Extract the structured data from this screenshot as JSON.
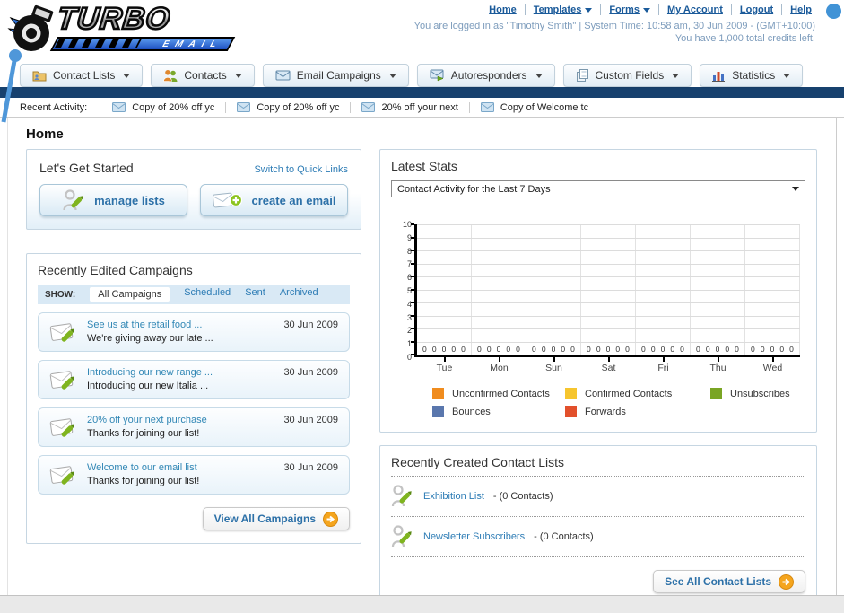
{
  "header": {
    "logo": {
      "line1": "TURBO",
      "line2": "EMAIL"
    },
    "nav": {
      "home": "Home",
      "templates": "Templates",
      "forms": "Forms",
      "my_account": "My Account",
      "logout": "Logout",
      "help": "Help"
    },
    "login_line1": "You are logged in as \"Timothy Smith\" | System Time: 10:58 am, 30 Jun 2009 - (GMT+10:00)",
    "login_line2": "You have 1,000 total credits left."
  },
  "tabs": [
    {
      "label": "Contact Lists",
      "icon": "contact-lists-icon"
    },
    {
      "label": "Contacts",
      "icon": "contacts-icon"
    },
    {
      "label": "Email Campaigns",
      "icon": "email-campaigns-icon"
    },
    {
      "label": "Autoresponders",
      "icon": "autoresponders-icon"
    },
    {
      "label": "Custom Fields",
      "icon": "custom-fields-icon"
    },
    {
      "label": "Statistics",
      "icon": "statistics-icon"
    }
  ],
  "recent_activity": {
    "label": "Recent Activity:",
    "items": [
      "Copy of 20% off yc",
      "Copy of 20% off yc",
      "20% off your next ",
      "Copy of Welcome tc"
    ]
  },
  "main": {
    "page_title": "Home",
    "get_started": {
      "title": "Let's Get Started",
      "switch_link": "Switch to Quick Links",
      "manage_lists_label": "manage lists",
      "create_email_label": "create an email"
    },
    "campaigns": {
      "title": "Recently Edited Campaigns",
      "show_label": "SHOW:",
      "filters": [
        "All Campaigns",
        "Scheduled",
        "Sent",
        "Archived"
      ],
      "active_filter": "All Campaigns",
      "items": [
        {
          "title": "See us at the retail food ...",
          "subtitle": "We're giving away our late ...",
          "date": "30 Jun 2009"
        },
        {
          "title": "Introducing our new range ...",
          "subtitle": "Introducing our new Italia ...",
          "date": "30 Jun 2009"
        },
        {
          "title": "20% off your next purchase",
          "subtitle": "Thanks for joining our list!",
          "date": "30 Jun 2009"
        },
        {
          "title": "Welcome to our email list",
          "subtitle": "Thanks for joining our list!",
          "date": "30 Jun 2009"
        }
      ],
      "view_all_label": "View All Campaigns"
    },
    "stats": {
      "title": "Latest Stats",
      "dropdown_value": "Contact Activity for the Last 7 Days"
    },
    "contact_lists": {
      "title": "Recently Created Contact Lists",
      "items": [
        {
          "name": "Exhibition List",
          "detail": "- (0 Contacts)"
        },
        {
          "name": "Newsletter Subscribers",
          "detail": "- (0 Contacts)"
        }
      ],
      "see_all_label": "See All Contact Lists"
    }
  },
  "chart_data": {
    "type": "bar",
    "title": "Contact Activity for the Last 7 Days",
    "categories": [
      "Tue",
      "Mon",
      "Sun",
      "Sat",
      "Fri",
      "Thu",
      "Wed"
    ],
    "series": [
      {
        "name": "Unconfirmed Contacts",
        "color": "#f08c1e",
        "values": [
          0,
          0,
          0,
          0,
          0,
          0,
          0
        ]
      },
      {
        "name": "Confirmed Contacts",
        "color": "#f6c52e",
        "values": [
          0,
          0,
          0,
          0,
          0,
          0,
          0
        ]
      },
      {
        "name": "Unsubscribes",
        "color": "#7aa524",
        "values": [
          0,
          0,
          0,
          0,
          0,
          0,
          0
        ]
      },
      {
        "name": "Bounces",
        "color": "#5a77ad",
        "values": [
          0,
          0,
          0,
          0,
          0,
          0,
          0
        ]
      },
      {
        "name": "Forwards",
        "color": "#e2502c",
        "values": [
          0,
          0,
          0,
          0,
          0,
          0,
          0
        ]
      }
    ],
    "ylim": [
      0,
      10
    ],
    "ytick_step": 1,
    "grid": true,
    "legend_position": "bottom"
  }
}
